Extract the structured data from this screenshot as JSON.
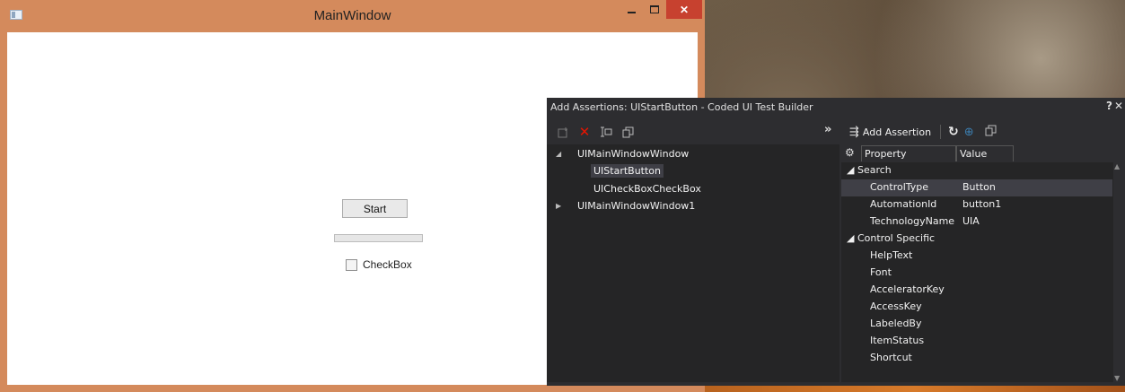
{
  "main_window": {
    "title": "MainWindow",
    "minimize_glyph": "",
    "close_glyph": "✕",
    "start_button_label": "Start",
    "progress_fraction": 0,
    "checkbox_label": "CheckBox",
    "checkbox_checked": false
  },
  "builder": {
    "title": "Add Assertions: UIStartButton - Coded UI Test Builder",
    "help_glyph": "?",
    "close_glyph": "✕",
    "collapse_glyph": "»",
    "left_toolbar": {
      "icons": [
        "add-control-icon",
        "delete-icon",
        "rename-icon",
        "copy-icon"
      ]
    },
    "tree": [
      {
        "label": "UIMainWindowWindow",
        "level": 0,
        "expanded": true
      },
      {
        "label": "UIStartButton",
        "level": 1,
        "selected": true
      },
      {
        "label": "UICheckBoxCheckBox",
        "level": 1
      },
      {
        "label": "UIMainWindowWindow1",
        "level": 0,
        "expanded": false
      }
    ],
    "right_toolbar": {
      "add_assertion_label": "Add Assertion"
    },
    "grid": {
      "header_property": "Property",
      "header_value": "Value",
      "categories": [
        {
          "name": "Search",
          "rows": [
            {
              "name": "ControlType",
              "value": "Button",
              "selected": true
            },
            {
              "name": "AutomationId",
              "value": "button1"
            },
            {
              "name": "TechnologyName",
              "value": "UIA"
            }
          ]
        },
        {
          "name": "Control Specific",
          "rows": [
            {
              "name": "HelpText",
              "value": ""
            },
            {
              "name": "Font",
              "value": ""
            },
            {
              "name": "AcceleratorKey",
              "value": ""
            },
            {
              "name": "AccessKey",
              "value": ""
            },
            {
              "name": "LabeledBy",
              "value": ""
            },
            {
              "name": "ItemStatus",
              "value": ""
            },
            {
              "name": "Shortcut",
              "value": ""
            }
          ]
        }
      ]
    }
  },
  "colors": {
    "main_frame": "#d48a5c",
    "close_button": "#c7412f",
    "builder_bg": "#2d2d30",
    "builder_pane": "#252526",
    "selection": "#3f3f46",
    "delete_red": "#e51400"
  }
}
